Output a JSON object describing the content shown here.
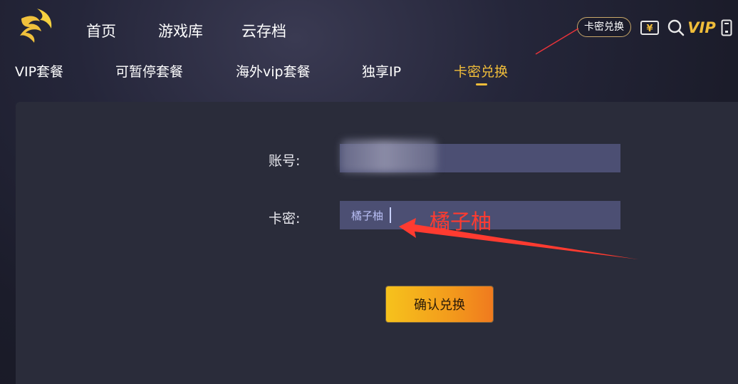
{
  "nav": {
    "items": [
      "首页",
      "游戏库",
      "云存档"
    ]
  },
  "tools": {
    "redeem_label": "卡密兑换",
    "yen_icon": "yen-icon",
    "search_icon": "search-icon",
    "vip_label": "VIP",
    "phone_icon": "phone-icon"
  },
  "subnav": {
    "items": [
      "VIP套餐",
      "可暂停套餐",
      "海外vip套餐",
      "独享IP",
      "卡密兑换"
    ],
    "active_index": 4
  },
  "form": {
    "account_label": "账号:",
    "account_value": "",
    "card_label": "卡密:",
    "card_value": "橘子柚",
    "submit_label": "确认兑换"
  },
  "annotation": {
    "text": "橘子柚",
    "color": "#ff3b30"
  },
  "colors": {
    "accent": "#f0bd3a",
    "panel": "#2a2c3a",
    "input_bg": "#4c4f73"
  }
}
